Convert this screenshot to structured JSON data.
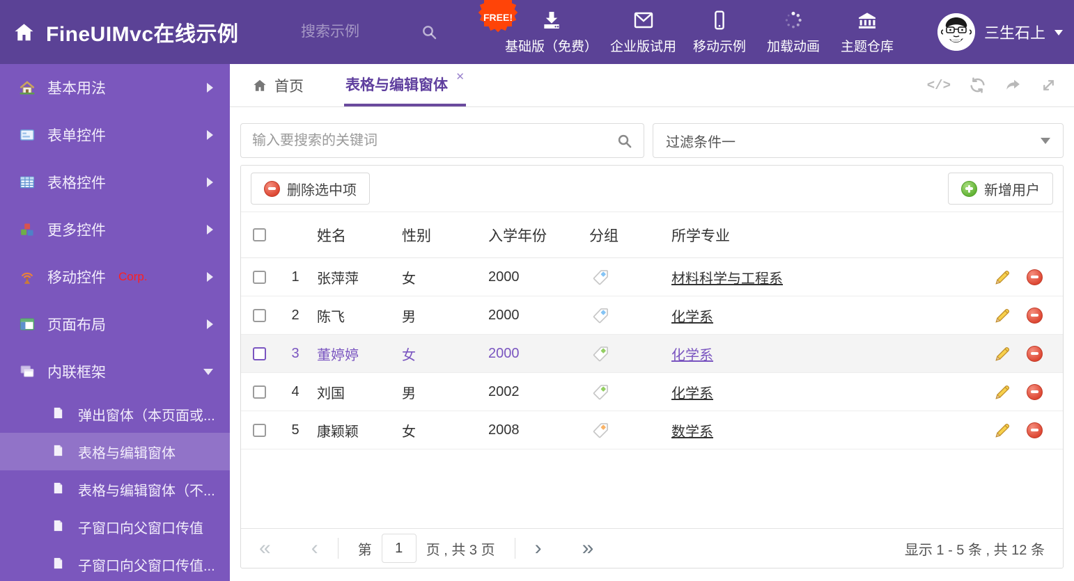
{
  "app": {
    "title": "FineUIMvc在线示例"
  },
  "colors": {
    "header_bg": "#5b4296",
    "sidebar_bg": "#7b57bd",
    "accent_purple": "#6a4a9e",
    "selected_row_text": "#7a55c0",
    "free_badge_bg": "#ff4408",
    "delete_red": "#dd4733",
    "add_green": "#62b335"
  },
  "header": {
    "home_icon": "home-icon",
    "search_placeholder": "搜索示例",
    "search_icon": "magnifier-icon",
    "free_badge": "FREE!",
    "nav": [
      {
        "label": "基础版（免费）",
        "icon": "download-icon"
      },
      {
        "label": "企业版试用",
        "icon": "envelope-icon"
      },
      {
        "label": "移动示例",
        "icon": "mobile-icon"
      },
      {
        "label": "加载动画",
        "icon": "spinner-icon"
      },
      {
        "label": "主题仓库",
        "icon": "bank-icon"
      }
    ],
    "user_name": "三生石上"
  },
  "sidebar": {
    "items": [
      {
        "label": "基本用法",
        "icon": "home-color-icon",
        "chev": "right"
      },
      {
        "label": "表单控件",
        "icon": "form-color-icon",
        "chev": "right"
      },
      {
        "label": "表格控件",
        "icon": "table-color-icon",
        "chev": "right"
      },
      {
        "label": "更多控件",
        "icon": "cubes-color-icon",
        "chev": "right"
      },
      {
        "label": "移动控件",
        "badge": "Corp.",
        "icon": "antenna-color-icon",
        "chev": "right"
      },
      {
        "label": "页面布局",
        "icon": "layout-color-icon",
        "chev": "right"
      },
      {
        "label": "内联框架",
        "icon": "frames-color-icon",
        "chev": "down"
      }
    ],
    "subitems": [
      {
        "label": "弹出窗体（本页面或...",
        "icon": "file-icon",
        "active": false
      },
      {
        "label": "表格与编辑窗体",
        "icon": "file-icon",
        "active": true
      },
      {
        "label": "表格与编辑窗体（不...",
        "icon": "file-icon",
        "active": false
      },
      {
        "label": "子窗口向父窗口传值",
        "icon": "file-icon",
        "active": false
      },
      {
        "label": "子窗口向父窗口传值...",
        "icon": "file-icon",
        "active": false
      }
    ]
  },
  "tabs": {
    "home_label": "首页",
    "active_label": "表格与编辑窗体",
    "close_glyph": "✕",
    "tools": [
      {
        "icon": "code-icon"
      },
      {
        "icon": "refresh-icon"
      },
      {
        "icon": "share-icon"
      },
      {
        "icon": "expand-icon"
      }
    ]
  },
  "filter": {
    "search_placeholder": "输入要搜索的关键词",
    "dropdown_value": "过滤条件一"
  },
  "toolbar": {
    "delete_label": "删除选中项",
    "add_label": "新增用户"
  },
  "table": {
    "headers": [
      "姓名",
      "性别",
      "入学年份",
      "分组",
      "所学专业"
    ],
    "rows": [
      {
        "num": "1",
        "name": "张萍萍",
        "gender": "女",
        "year": "2000",
        "tag_color": "#85c4f5",
        "major": "材料科学与工程系",
        "selected": false
      },
      {
        "num": "2",
        "name": "陈飞",
        "gender": "男",
        "year": "2000",
        "tag_color": "#85c4f5",
        "major": "化学系",
        "selected": false
      },
      {
        "num": "3",
        "name": "董婷婷",
        "gender": "女",
        "year": "2000",
        "tag_color": "#93ce62",
        "major": "化学系",
        "selected": true
      },
      {
        "num": "4",
        "name": "刘国",
        "gender": "男",
        "year": "2002",
        "tag_color": "#93ce62",
        "major": "化学系",
        "selected": false
      },
      {
        "num": "5",
        "name": "康颖颖",
        "gender": "女",
        "year": "2008",
        "tag_color": "#f9b367",
        "major": "数学系",
        "selected": false
      }
    ]
  },
  "pagination": {
    "first": "«",
    "prev": "‹",
    "next": "›",
    "last": "»",
    "page_prefix": "第",
    "page_value": "1",
    "page_suffix": "页 , 共 3 页",
    "summary": "显示 1 - 5 条 , 共 12 条"
  }
}
